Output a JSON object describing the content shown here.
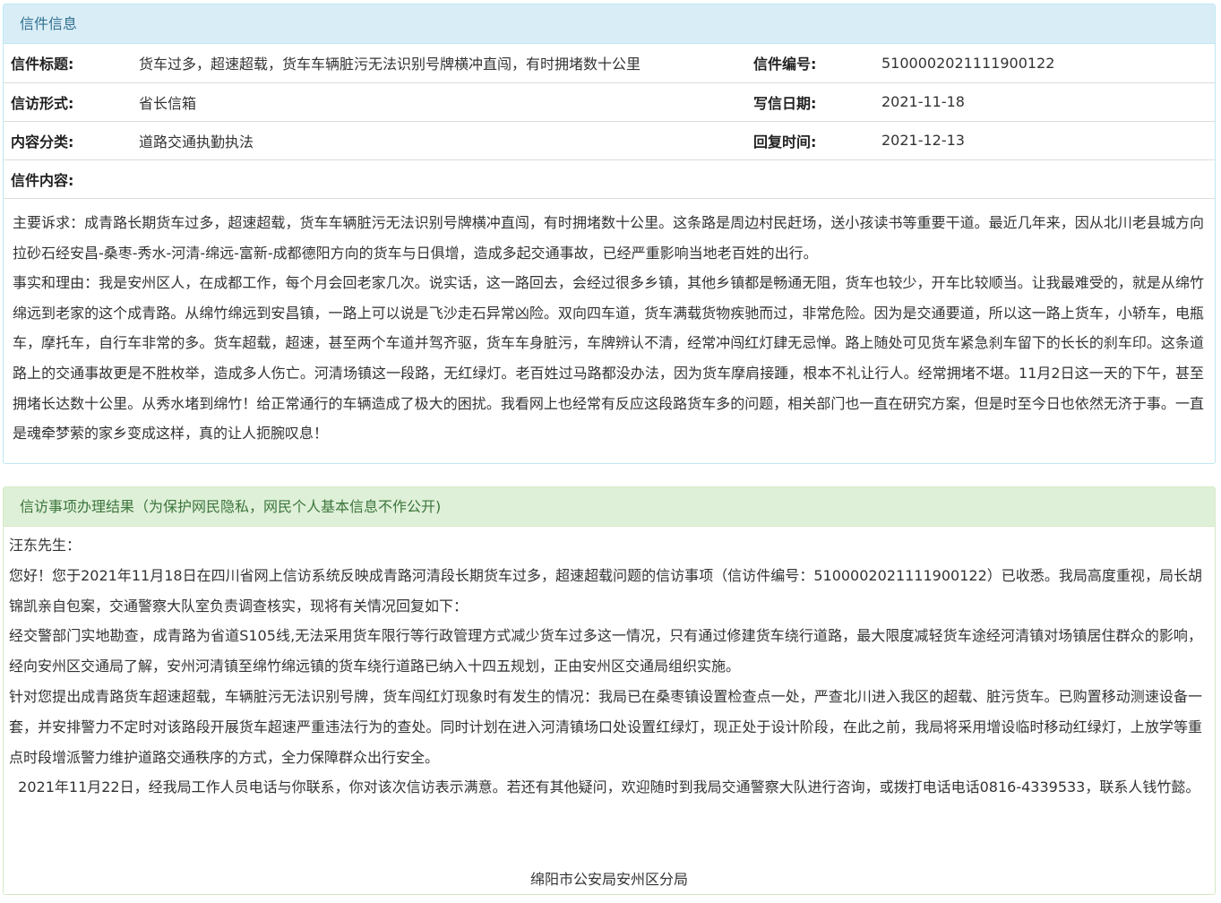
{
  "letter_panel": {
    "heading": "信件信息",
    "rows": [
      {
        "label1": "信件标题:",
        "value1": "货车过多，超速超载，货车车辆脏污无法识别号牌横冲直闯，有时拥堵数十公里",
        "label2": "信件编号:",
        "value2": "5100002021111900122"
      },
      {
        "label1": "信访形式:",
        "value1": "省长信箱",
        "label2": "写信日期:",
        "value2": "2021-11-18"
      },
      {
        "label1": "内容分类:",
        "value1": "道路交通执勤执法",
        "label2": "回复时间:",
        "value2": "2021-12-13"
      }
    ],
    "content_label": "信件内容:",
    "content_paragraphs": [
      "主要诉求：成青路长期货车过多，超速超载，货车车辆脏污无法识别号牌横冲直闯，有时拥堵数十公里。这条路是周边村民赶场，送小孩读书等重要干道。最近几年来，因从北川老县城方向拉砂石经安昌-桑枣-秀水-河清-绵远-富新-成都德阳方向的货车与日俱增，造成多起交通事故，已经严重影响当地老百姓的出行。",
      "事实和理由：我是安州区人，在成都工作，每个月会回老家几次。说实话，这一路回去，会经过很多乡镇，其他乡镇都是畅通无阻，货车也较少，开车比较顺当。让我最难受的，就是从绵竹绵远到老家的这个成青路。从绵竹绵远到安昌镇，一路上可以说是飞沙走石异常凶险。双向四车道，货车满载货物疾驰而过，非常危险。因为是交通要道，所以这一路上货车，小轿车，电瓶车，摩托车，自行车非常的多。货车超载，超速，甚至两个车道并驾齐驱，货车车身脏污，车牌辨认不清，经常冲闯红灯肆无忌惮。路上随处可见货车紧急刹车留下的长长的刹车印。这条道路上的交通事故更是不胜枚举，造成多人伤亡。河清场镇这一段路，无红绿灯。老百姓过马路都没办法，因为货车摩肩接踵，根本不礼让行人。经常拥堵不堪。11月2日这一天的下午，甚至拥堵长达数十公里。从秀水堵到绵竹！给正常通行的车辆造成了极大的困扰。我看网上也经常有反应这段路货车多的问题，相关部门也一直在研究方案，但是时至今日也依然无济于事。一直是魂牵梦萦的家乡变成这样，真的让人扼腕叹息！"
    ]
  },
  "reply_panel": {
    "heading": "信访事项办理结果（为保护网民隐私，网民个人基本信息不作公开)",
    "paragraphs": [
      "汪东先生：",
      "您好！您于2021年11月18日在四川省网上信访系统反映成青路河清段长期货车过多，超速超载问题的信访事项（信访件编号：5100002021111900122）已收悉。我局高度重视，局长胡锦凯亲自包案，交通警察大队室负责调查核实，现将有关情况回复如下：",
      "经交警部门实地勘查，成青路为省道S105线,无法采用货车限行等行政管理方式减少货车过多这一情况，只有通过修建货车绕行道路，最大限度减轻货车途经河清镇对场镇居住群众的影响，经向安州区交通局了解，安州河清镇至绵竹绵远镇的货车绕行道路已纳入十四五规划，正由安州区交通局组织实施。",
      "针对您提出成青路货车超速超载，车辆脏污无法识别号牌，货车闯红灯现象时有发生的情况：我局已在桑枣镇设置检查点一处，严查北川进入我区的超载、脏污货车。已购置移动测速设备一套，并安排警力不定时对该路段开展货车超速严重违法行为的查处。同时计划在进入河清镇场口处设置红绿灯，现正处于设计阶段，在此之前，我局将采用增设临时移动红绿灯，上放学等重点时段增派警力维护道路交通秩序的方式，全力保障群众出行安全。",
      "  2021年11月22日，经我局工作人员电话与你联系，你对该次信访表示满意。若还有其他疑问，欢迎随时到我局交通警察大队进行咨询，或拨打电话电话0816-4339533，联系人钱竹懿。"
    ],
    "signature": "绵阳市公安局安州区分局"
  },
  "colors": {
    "info_heading_bg": "#d9edf7",
    "info_heading_text": "#31708f",
    "success_heading_bg": "#dff0d8",
    "success_heading_text": "#3c763d"
  }
}
